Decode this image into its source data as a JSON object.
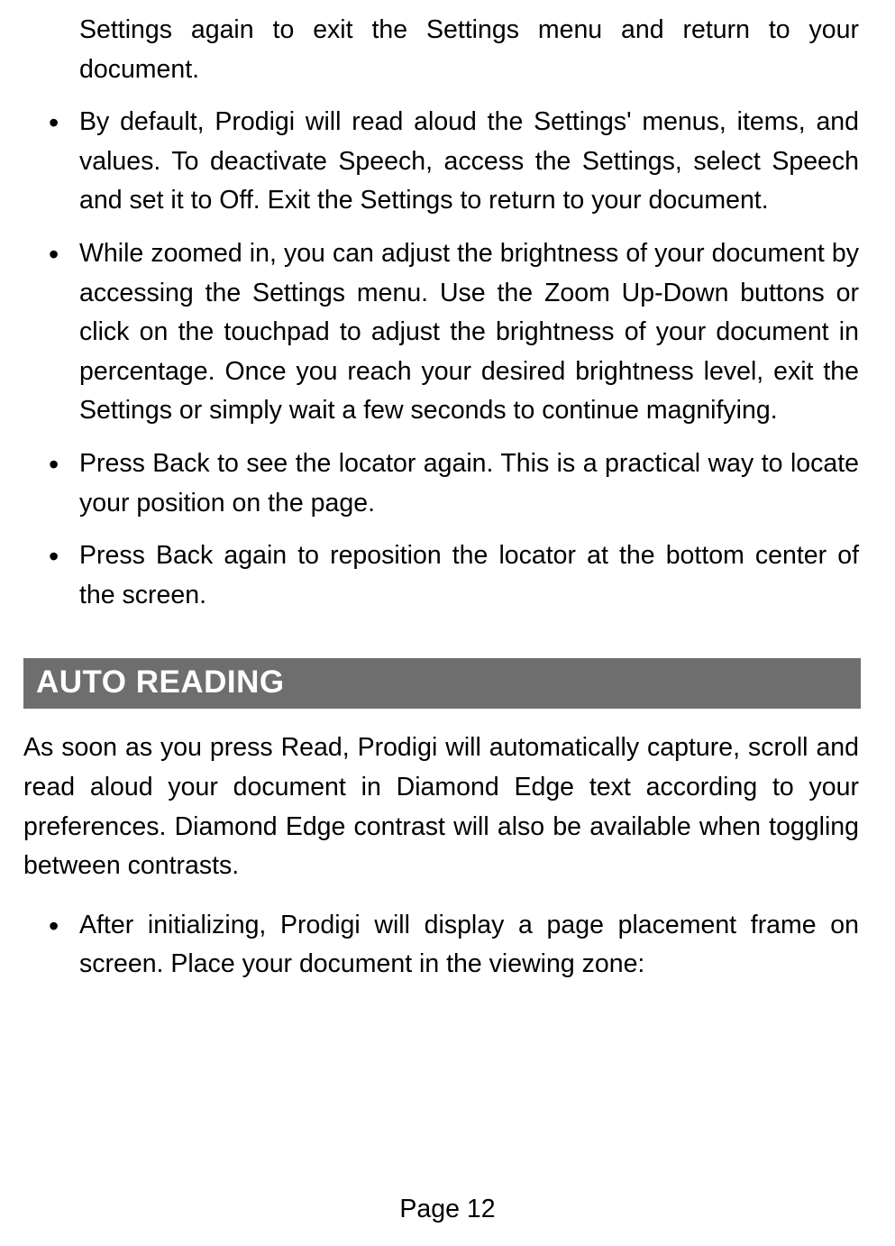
{
  "top_list": {
    "continuation": "Settings again to exit the Settings menu and return to your document.",
    "items": [
      "By default, Prodigi will read aloud the Settings' menus, items, and values. To deactivate Speech, access the Settings, select Speech and set it to Off. Exit the Settings to return to your document.",
      "While zoomed in, you can adjust the brightness of your document by accessing the Settings menu. Use the Zoom Up-Down buttons or click on the touchpad to adjust the brightness of your document in percentage. Once you reach your desired brightness level, exit the Settings or simply wait a few seconds to continue magnifying.",
      "Press Back to see the locator again. This is a practical way to locate your position on the page.",
      "Press Back again to reposition the locator at the bottom center of the screen."
    ]
  },
  "section": {
    "heading": "AUTO READING",
    "paragraph": "As soon as you press Read, Prodigi will automatically capture, scroll and read aloud your document in Diamond Edge text according to your preferences. Diamond Edge contrast will also be available when toggling between contrasts.",
    "items": [
      "After initializing, Prodigi will display a page placement frame on screen. Place your document in the viewing zone:"
    ]
  },
  "page_number": "Page 12"
}
